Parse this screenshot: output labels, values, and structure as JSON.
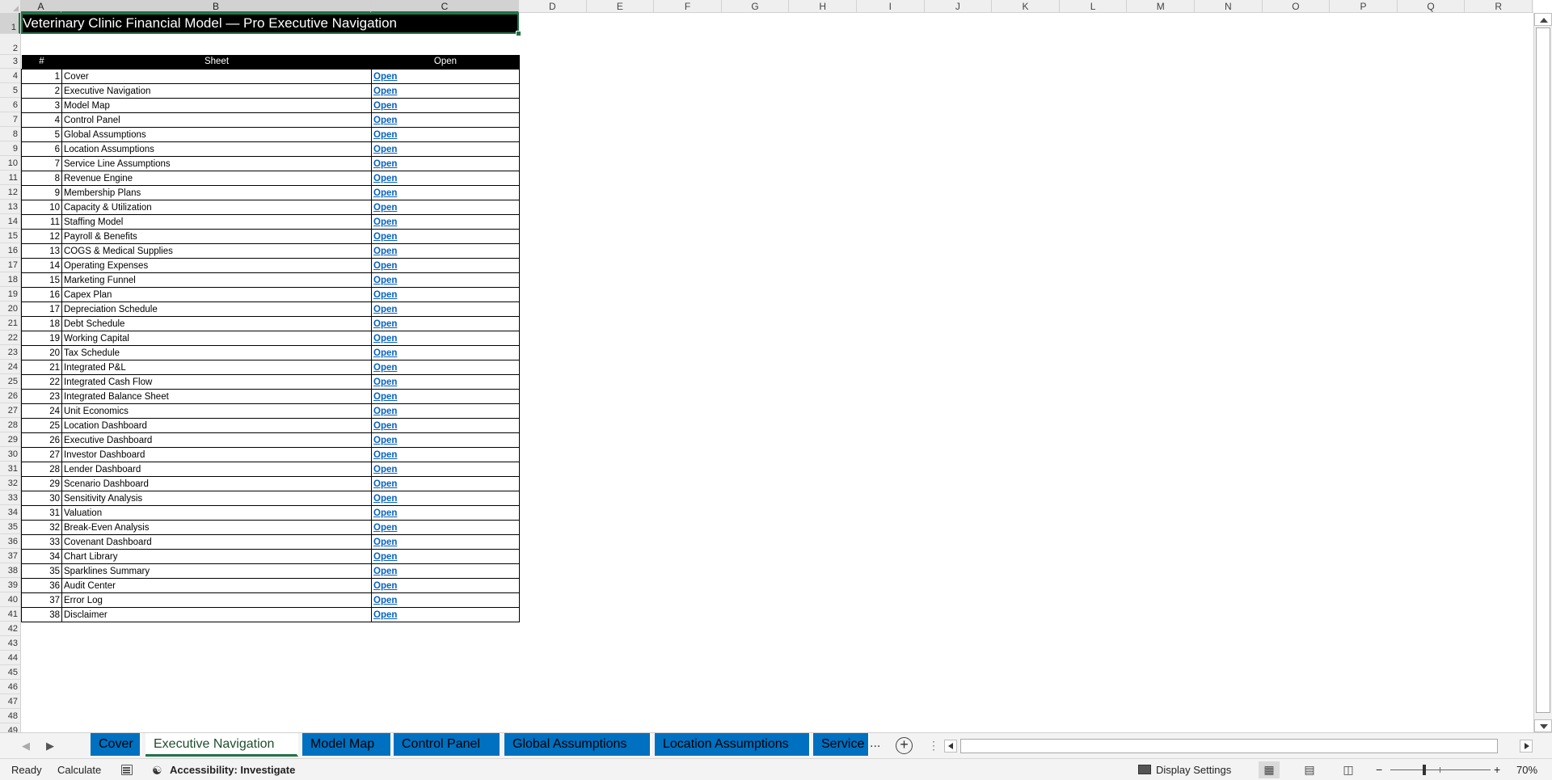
{
  "columns": [
    "A",
    "B",
    "C",
    "D",
    "E",
    "F",
    "G",
    "H",
    "I",
    "J",
    "K",
    "L",
    "M",
    "N",
    "O",
    "P",
    "Q",
    "R"
  ],
  "selected_columns": [
    "A",
    "B",
    "C"
  ],
  "rows": [
    "1",
    "2",
    "3",
    "4",
    "5",
    "6",
    "7",
    "8",
    "9",
    "10",
    "11",
    "12",
    "13",
    "14",
    "15",
    "16",
    "17",
    "18",
    "19",
    "20",
    "21",
    "22",
    "23",
    "24",
    "25",
    "26",
    "27",
    "28",
    "29",
    "30",
    "31",
    "32",
    "33",
    "34",
    "35",
    "36",
    "37",
    "38",
    "39",
    "40",
    "41",
    "42",
    "43",
    "44",
    "45",
    "46",
    "47",
    "48",
    "49"
  ],
  "selected_row": "1",
  "title": "Veterinary Clinic Financial Model — Pro Executive Navigation",
  "table": {
    "headers": [
      "#",
      "Sheet",
      "Open"
    ],
    "link_text": "Open",
    "rows": [
      {
        "num": "1",
        "sheet": "Cover"
      },
      {
        "num": "2",
        "sheet": "Executive Navigation"
      },
      {
        "num": "3",
        "sheet": "Model Map"
      },
      {
        "num": "4",
        "sheet": "Control Panel"
      },
      {
        "num": "5",
        "sheet": "Global Assumptions"
      },
      {
        "num": "6",
        "sheet": "Location Assumptions"
      },
      {
        "num": "7",
        "sheet": "Service Line Assumptions"
      },
      {
        "num": "8",
        "sheet": "Revenue Engine"
      },
      {
        "num": "9",
        "sheet": "Membership Plans"
      },
      {
        "num": "10",
        "sheet": "Capacity & Utilization"
      },
      {
        "num": "11",
        "sheet": "Staffing Model"
      },
      {
        "num": "12",
        "sheet": "Payroll & Benefits"
      },
      {
        "num": "13",
        "sheet": "COGS & Medical Supplies"
      },
      {
        "num": "14",
        "sheet": "Operating Expenses"
      },
      {
        "num": "15",
        "sheet": "Marketing Funnel"
      },
      {
        "num": "16",
        "sheet": "Capex Plan"
      },
      {
        "num": "17",
        "sheet": "Depreciation Schedule"
      },
      {
        "num": "18",
        "sheet": "Debt Schedule"
      },
      {
        "num": "19",
        "sheet": "Working Capital"
      },
      {
        "num": "20",
        "sheet": "Tax Schedule"
      },
      {
        "num": "21",
        "sheet": "Integrated P&L"
      },
      {
        "num": "22",
        "sheet": "Integrated Cash Flow"
      },
      {
        "num": "23",
        "sheet": "Integrated Balance Sheet"
      },
      {
        "num": "24",
        "sheet": "Unit Economics"
      },
      {
        "num": "25",
        "sheet": "Location Dashboard"
      },
      {
        "num": "26",
        "sheet": "Executive Dashboard"
      },
      {
        "num": "27",
        "sheet": "Investor Dashboard"
      },
      {
        "num": "28",
        "sheet": "Lender Dashboard"
      },
      {
        "num": "29",
        "sheet": "Scenario Dashboard"
      },
      {
        "num": "30",
        "sheet": "Sensitivity Analysis"
      },
      {
        "num": "31",
        "sheet": "Valuation"
      },
      {
        "num": "32",
        "sheet": "Break-Even Analysis"
      },
      {
        "num": "33",
        "sheet": "Covenant Dashboard"
      },
      {
        "num": "34",
        "sheet": "Chart Library"
      },
      {
        "num": "35",
        "sheet": "Sparklines Summary"
      },
      {
        "num": "36",
        "sheet": "Audit Center"
      },
      {
        "num": "37",
        "sheet": "Error Log"
      },
      {
        "num": "38",
        "sheet": "Disclaimer"
      }
    ]
  },
  "sheet_tabs": [
    {
      "label": "Cover",
      "active": false
    },
    {
      "label": "Executive Navigation",
      "active": true
    },
    {
      "label": "Model Map",
      "active": false
    },
    {
      "label": "Control Panel",
      "active": false
    },
    {
      "label": "Global Assumptions",
      "active": false
    },
    {
      "label": "Location Assumptions",
      "active": false
    },
    {
      "label": "Service",
      "active": false
    }
  ],
  "tab_overflow": "...",
  "tab_color": "#0070c0",
  "accent_color": "#217346",
  "link_color": "#0563c1",
  "status": {
    "ready": "Ready",
    "calculate": "Calculate",
    "accessibility": "Accessibility: Investigate",
    "display_settings": "Display Settings",
    "zoom": "70%",
    "zoom_minus": "−",
    "zoom_plus": "+"
  },
  "icons": {
    "calc_options": "calculation-options-icon",
    "accessibility": "accessibility-icon",
    "display": "display-settings-icon",
    "normal_view": "normal-view-icon",
    "page_layout": "page-layout-view-icon",
    "page_break": "page-break-preview-icon",
    "add_sheet": "add-sheet-icon"
  }
}
